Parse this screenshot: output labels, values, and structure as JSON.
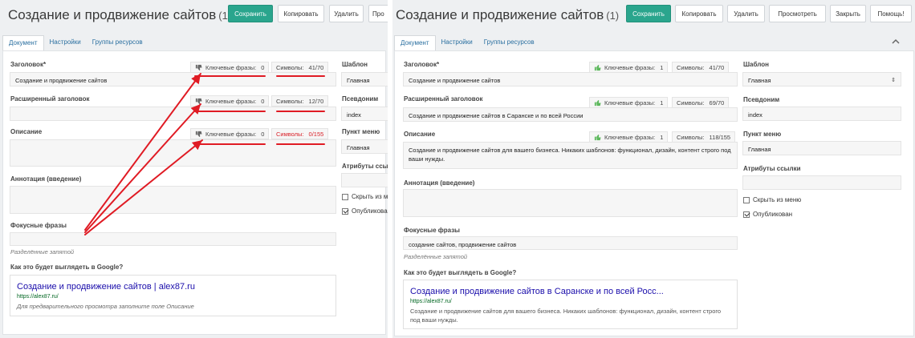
{
  "left": {
    "title": "Создание и продвижение сайтов",
    "count": "(1)",
    "buttons": {
      "save": "Сохранить",
      "copy": "Копировать",
      "delete": "Удалить",
      "view": "Про"
    },
    "tabs": [
      "Документ",
      "Настройки",
      "Группы ресурсов"
    ],
    "fields": {
      "heading_label": "Заголовок*",
      "heading_value": "Создание и продвижение сайтов",
      "ext_heading_label": "Расширенный заголовок",
      "ext_heading_value": "",
      "description_label": "Описание",
      "description_value": "",
      "annotation_label": "Аннотация (введение)",
      "focus_label": "Фокусные фразы",
      "focus_value": "",
      "focus_hint": "Разделённые запятой",
      "google_label": "Как это будет выглядеть в Google?"
    },
    "badges": [
      {
        "kw_label": "Ключевые фразы:",
        "kw_value": "0",
        "sym_label": "Символы:",
        "sym_value": "41/70"
      },
      {
        "kw_label": "Ключевые фразы:",
        "kw_value": "0",
        "sym_label": "Символы:",
        "sym_value": "12/70"
      },
      {
        "kw_label": "Ключевые фразы:",
        "kw_value": "0",
        "sym_label": "Символы:",
        "sym_value": "0/155"
      }
    ],
    "side": {
      "template_label": "Шаблон",
      "template_value": "Главная",
      "alias_label": "Псевдоним",
      "alias_value": "index",
      "menu_label": "Пункт меню",
      "menu_value": "Главная",
      "link_attr_label": "Атрибуты ссылк",
      "hide_menu_label": "Скрыть из м",
      "published_label": "Опубликова"
    },
    "google": {
      "title": "Создание и продвижение сайтов | alex87.ru",
      "url": "https://alex87.ru/",
      "desc": "Для предварительного просмотра заполните поле Описание"
    }
  },
  "right": {
    "title": "Создание и продвижение сайтов",
    "count": "(1)",
    "buttons": {
      "save": "Сохранить",
      "copy": "Копировать",
      "delete": "Удалить",
      "view": "Просмотреть",
      "close": "Закрыть",
      "help": "Помощь!"
    },
    "tabs": [
      "Документ",
      "Настройки",
      "Группы ресурсов"
    ],
    "fields": {
      "heading_label": "Заголовок*",
      "heading_value": "Создание и продвижение сайтов",
      "ext_heading_label": "Расширенный заголовок",
      "ext_heading_value": "Создание и продвижение сайтов в Саранске и по всей России",
      "description_label": "Описание",
      "description_value": "Создание и продвижение сайтов для вашего бизнеса. Никаких шаблонов: функционал, дизайн, контент строго под ваши нужды.",
      "annotation_label": "Аннотация (введение)",
      "focus_label": "Фокусные фразы",
      "focus_value": "создание сайтов, продвижение сайтов",
      "focus_hint": "Разделённые запятой",
      "google_label": "Как это будет выглядеть в Google?"
    },
    "badges": [
      {
        "kw_label": "Ключевые фразы:",
        "kw_value": "1",
        "sym_label": "Символы:",
        "sym_value": "41/70"
      },
      {
        "kw_label": "Ключевые фразы:",
        "kw_value": "1",
        "sym_label": "Символы:",
        "sym_value": "69/70"
      },
      {
        "kw_label": "Ключевые фразы:",
        "kw_value": "1",
        "sym_label": "Символы:",
        "sym_value": "118/155"
      }
    ],
    "side": {
      "template_label": "Шаблон",
      "template_value": "Главная",
      "alias_label": "Псевдоним",
      "alias_value": "index",
      "menu_label": "Пункт меню",
      "menu_value": "Главная",
      "link_attr_label": "Атрибуты ссылки",
      "hide_menu_label": "Скрыть из меню",
      "published_label": "Опубликован"
    },
    "google": {
      "title": "Создание и продвижение сайтов в Саранске и по всей Росс...",
      "url": "https://alex87.ru/",
      "desc": "Создание и продвижение сайтов для вашего бизнеса. Никаких шаблонов: функционал, дизайн, контент строго под ваши нужды."
    }
  },
  "colors": {
    "accent": "#2aa58d",
    "link": "#1a0dab",
    "url": "#006621",
    "annotation_red": "#e01b24",
    "thumb_down": "#666666",
    "thumb_up": "#5cb85c"
  },
  "icons": {
    "thumb_down": "thumb-down-icon",
    "thumb_up": "thumb-up-icon",
    "collapse": "chevron-up-icon",
    "select": "select-arrows-icon"
  }
}
